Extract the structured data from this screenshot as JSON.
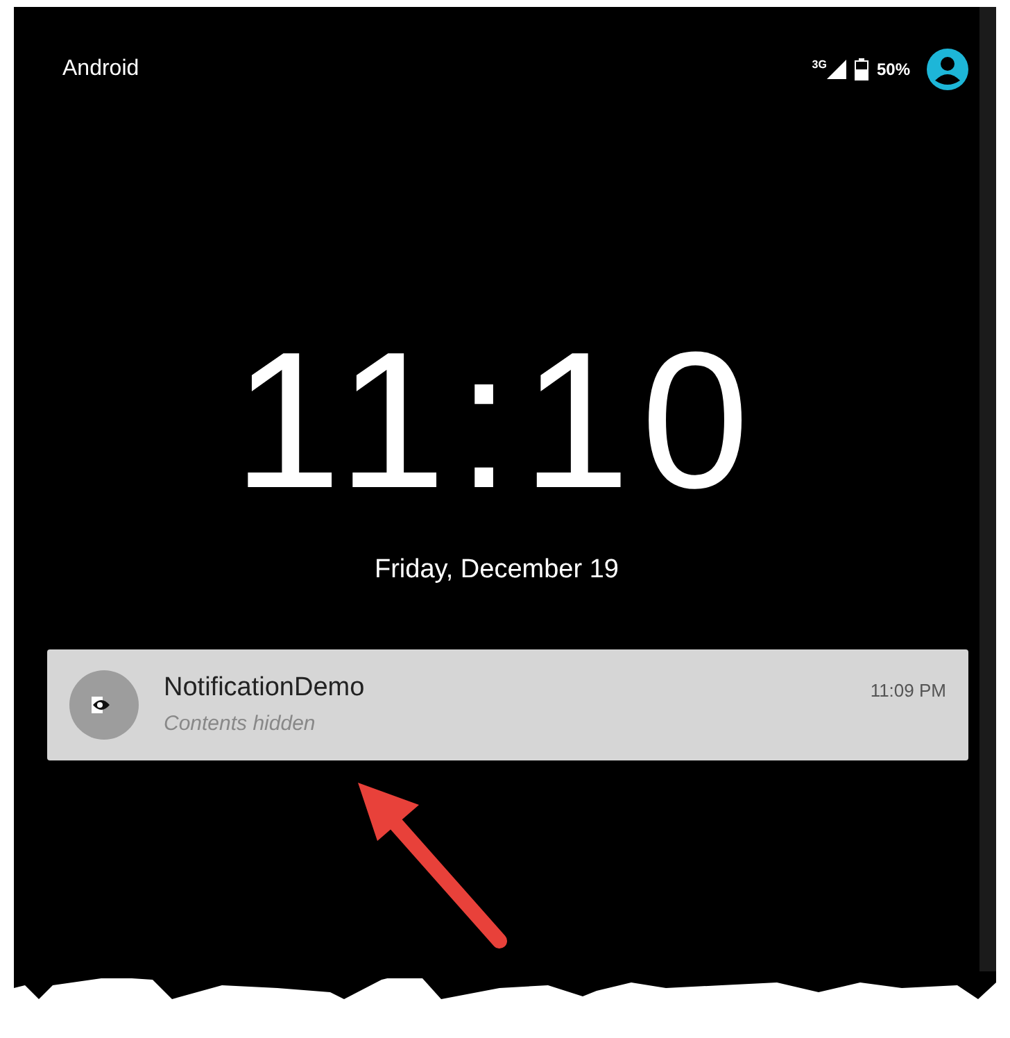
{
  "status_bar": {
    "carrier": "Android",
    "network": "3G",
    "battery": "50%"
  },
  "clock": {
    "time": "11:10",
    "date": "Friday, December 19"
  },
  "notifications": [
    {
      "app": "NotificationDemo",
      "text": "Contents hidden",
      "time": "11:09 PM"
    }
  ]
}
